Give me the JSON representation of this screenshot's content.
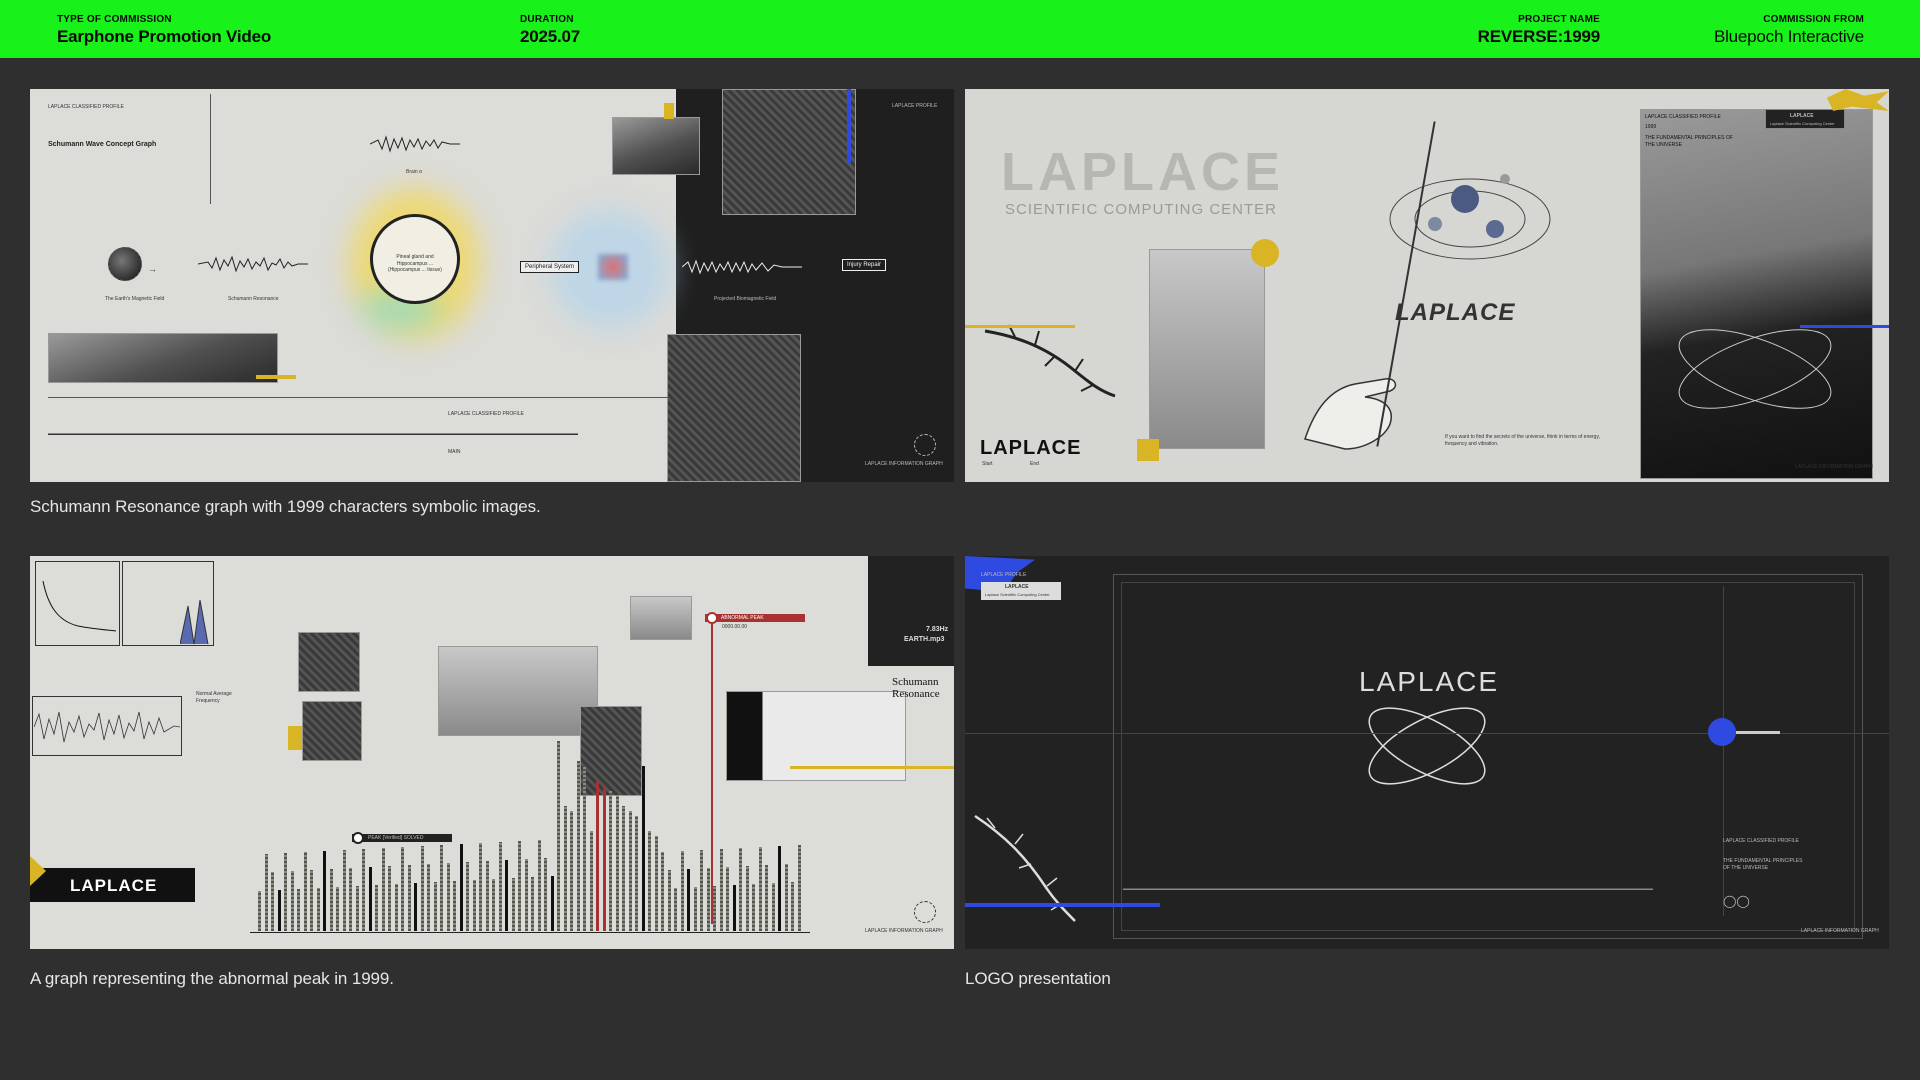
{
  "header": {
    "commission_type_label": "TYPE OF COMMISSION",
    "commission_type": "Earphone Promotion Video",
    "duration_label": "DURATION",
    "duration": "2025.07",
    "project_label": "PROJECT NAME",
    "project": "REVERSE:1999",
    "from_label": "COMMISSION FROM",
    "from": "Bluepoch Interactive"
  },
  "panels": {
    "p1": {
      "caption": "Schumann Resonance graph with 1999 characters symbolic images.",
      "title": "Schumann Wave Concept Graph",
      "brain": "Brain α",
      "earth": "The Earth's Magnetic Field",
      "resonance": "Schumann Resonance",
      "pineal": "Pineal gland and Hippocampus ... (Hippocampus ... tissue)",
      "peripheral": "Peripheral System",
      "projected": "Projected Biomagnetic Field",
      "injury": "Injury Repair",
      "profile": "LAPLACE PROFILE",
      "footer": "LAPLACE INFORMATION GRAPH",
      "classified": "LAPLACE CLASSIFIED PROFILE",
      "main": "MAIN"
    },
    "p2": {
      "caption": "",
      "logo": "LAPLACE",
      "sub": "SCIENTIFIC COMPUTING CENTER",
      "classified": "LAPLACE CLASSIFIED PROFILE",
      "principles": "THE FUNDAMENTAL PRINCIPLES OF THE UNIVERSE",
      "year": "1999",
      "quote": "If you want to find the secrets of the universe, think in terms of energy, frequency and vibration.",
      "badge": "LAPLACE",
      "badge_sub": "Laplace Scientific Computing Center",
      "footer": "LAPLACE INFORMATION GRAPH",
      "start": "Start",
      "end": "End"
    },
    "p3": {
      "caption": "A graph representing the abnormal peak in 1999.",
      "peak": "ABNORMAL PEAK",
      "peak_val": "0000.00.00",
      "solved": "PEAK [Verified] SOLVED",
      "freq": "7.83Hz",
      "earth_mp3": "EARTH.mp3",
      "overlay": "Schumann Resonance",
      "logo": "LAPLACE",
      "footer": "LAPLACE INFORMATION GRAPH",
      "normal": "Normal Average Frequency"
    },
    "p4": {
      "caption": "LOGO presentation",
      "logo": "LAPLACE",
      "profile": "LAPLACE PROFILE",
      "badge": "LAPLACE",
      "badge_sub": "Laplace Scientific Computing Center",
      "classified": "LAPLACE CLASSIFIED PROFILE",
      "principles": "THE FUNDAMENTAL PRINCIPLES OF THE UNIVERSE",
      "footer": "LAPLACE INFORMATION GRAPH"
    }
  },
  "colors": {
    "header": "#19f21a",
    "bg": "#2f2f2f",
    "accent_blue": "#2f4ae0",
    "accent_yellow": "#d9b526"
  }
}
